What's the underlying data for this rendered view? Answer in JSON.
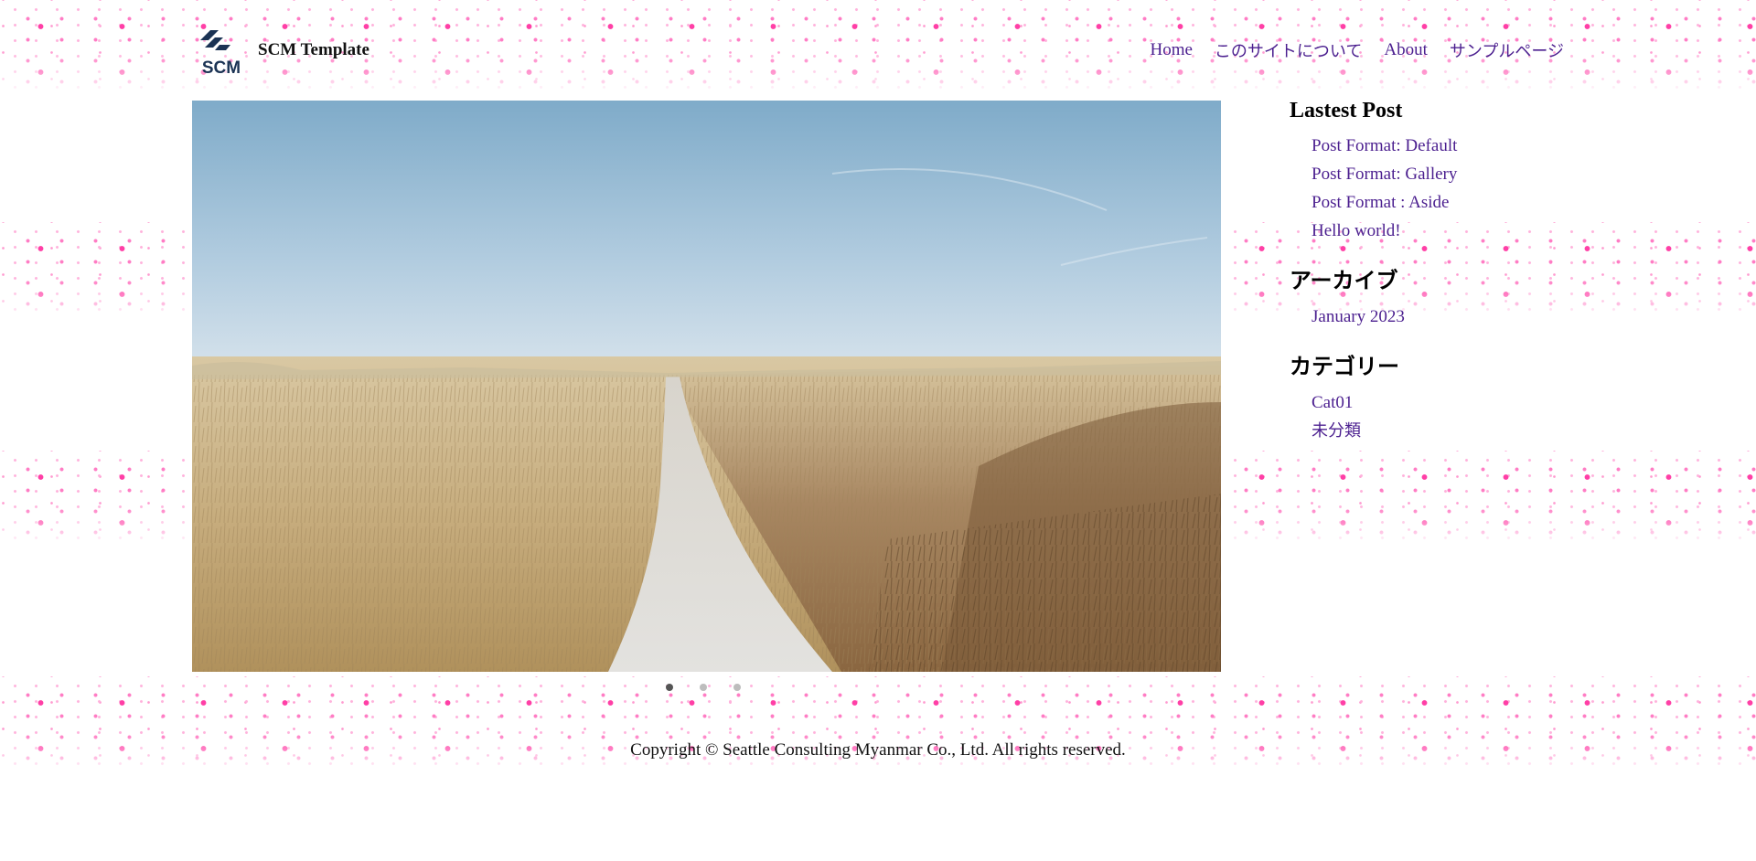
{
  "header": {
    "logo_text": "SCM",
    "site_title": "SCM Template",
    "nav": [
      {
        "label": "Home"
      },
      {
        "label": "このサイトについて"
      },
      {
        "label": "About"
      },
      {
        "label": "サンプルページ"
      }
    ]
  },
  "hero": {
    "slide_index": 1,
    "slide_count": 3
  },
  "sidebar": {
    "latest": {
      "title": "Lastest Post",
      "items": [
        "Post Format: Default",
        "Post Format: Gallery",
        "Post Format : Aside",
        "Hello world!"
      ]
    },
    "archive": {
      "title": "アーカイブ",
      "items": [
        "January 2023"
      ]
    },
    "category": {
      "title": "カテゴリー",
      "items": [
        "Cat01",
        "未分類"
      ]
    }
  },
  "footer": {
    "copyright": "Copyright © Seattle Consulting Myanmar Co., Ltd. All rights reserved."
  },
  "colors": {
    "link": "#4b1f8f",
    "heart_pink": "#ff3fa6",
    "logo_navy": "#1b3354"
  }
}
